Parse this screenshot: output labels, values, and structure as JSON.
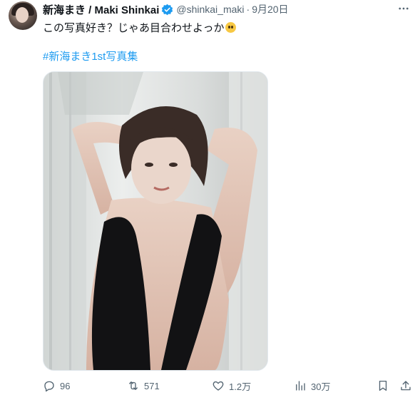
{
  "tweet": {
    "display_name": "新海まき / Maki Shinkai",
    "handle": "@shinkai_maki",
    "separator": "·",
    "date": "9月20日",
    "text": "この写真好き？じゃあ目合わせよっか",
    "hashtag": "#新海まき1st写真集",
    "verified_color": "#1d9bf0"
  },
  "actions": {
    "replies": "96",
    "retweets": "571",
    "likes": "1.2万",
    "views": "30万"
  },
  "icons": [
    "avatar",
    "verified-badge-icon",
    "more-icon",
    "reply-icon",
    "retweet-icon",
    "like-icon",
    "views-icon",
    "bookmark-icon",
    "share-icon",
    "pleading-face-emoji"
  ]
}
